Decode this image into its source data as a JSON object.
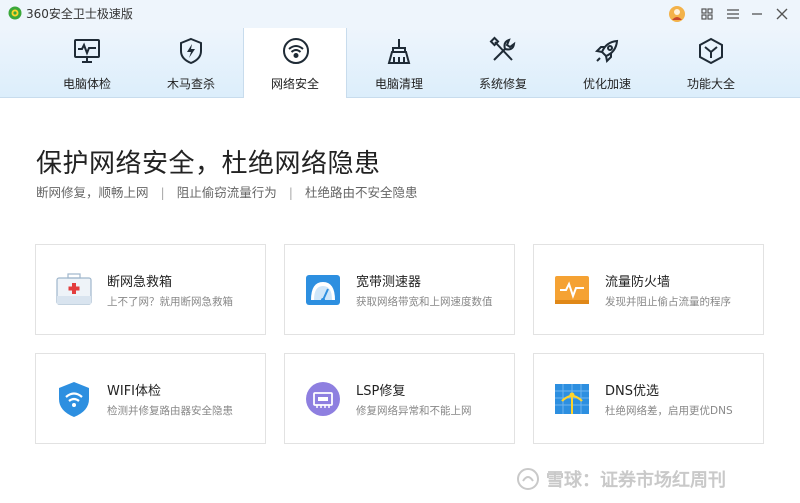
{
  "window": {
    "title": "360安全卫士极速版"
  },
  "colors": {
    "accent": "#2d8fe0",
    "toolbar_bg": "#e6f2fc",
    "icon_dark": "#1f2b36"
  },
  "tabs": [
    {
      "label": "电脑体检",
      "icon": "monitor-pulse-icon"
    },
    {
      "label": "木马查杀",
      "icon": "shield-bolt-icon"
    },
    {
      "label": "网络安全",
      "icon": "wifi-circle-icon",
      "active": true
    },
    {
      "label": "电脑清理",
      "icon": "broom-icon"
    },
    {
      "label": "系统修复",
      "icon": "tools-icon"
    },
    {
      "label": "优化加速",
      "icon": "rocket-icon"
    },
    {
      "label": "功能大全",
      "icon": "hexagon-check-icon"
    }
  ],
  "main": {
    "title": "保护网络安全，杜绝网络隐患",
    "subtitle": [
      "断网修复，顺畅上网",
      "阻止偷窃流量行为",
      "杜绝路由不安全隐患"
    ],
    "separator": "|"
  },
  "cards": [
    {
      "title": "断网急救箱",
      "desc": "上不了网？就用断网急救箱",
      "icon": "first-aid-kit-icon"
    },
    {
      "title": "宽带测速器",
      "desc": "获取网络带宽和上网速度数值",
      "icon": "speedometer-icon"
    },
    {
      "title": "流量防火墙",
      "desc": "发现并阻止偷占流量的程序",
      "icon": "firewall-icon"
    },
    {
      "title": "WIFI体检",
      "desc": "检测并修复路由器安全隐患",
      "icon": "wifi-shield-icon"
    },
    {
      "title": "LSP修复",
      "desc": "修复网络异常和不能上网",
      "icon": "network-card-icon"
    },
    {
      "title": "DNS优选",
      "desc": "杜绝网络差，启用更优DNS",
      "icon": "globe-antenna-icon"
    }
  ],
  "watermark": {
    "text": "雪球：证券市场红周刊"
  }
}
